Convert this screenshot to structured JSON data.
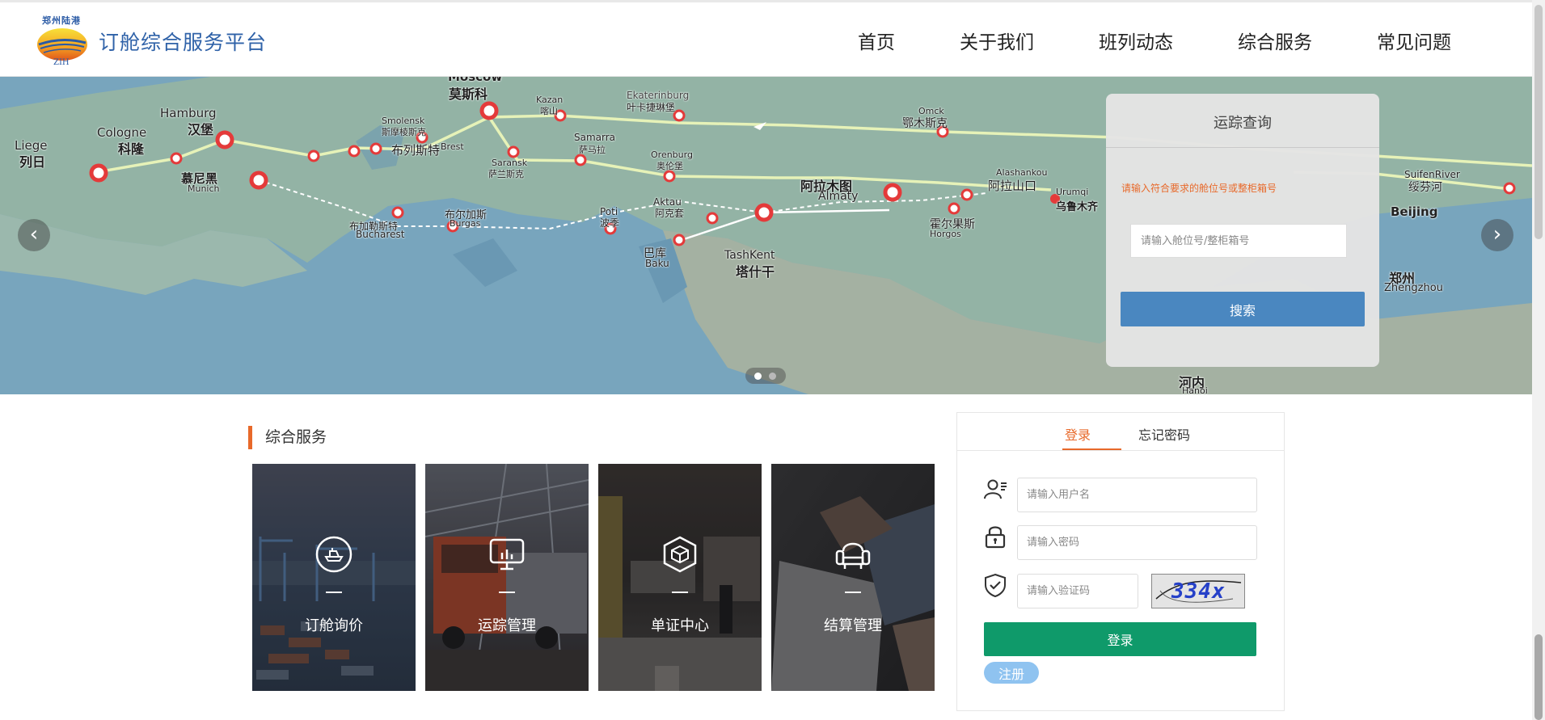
{
  "header": {
    "logo_top": "郑州陆港",
    "logo_sub": "ZIH",
    "brand": "订舱综合服务平台",
    "nav": [
      "首页",
      "关于我们",
      "班列动态",
      "综合服务",
      "常见问题"
    ]
  },
  "banner": {
    "cities": [
      {
        "cn": "莫斯科",
        "en": "Moscow"
      },
      {
        "cn": "汉堡",
        "en": "Hamburg"
      },
      {
        "cn": "科隆",
        "en": "Cologne"
      },
      {
        "cn": "列日",
        "en": "Liege"
      },
      {
        "cn": "慕尼黑",
        "en": "Munich"
      },
      {
        "cn": "斯摩棱斯克",
        "en": "Smolensk"
      },
      {
        "cn": "布列斯特",
        "en": "Brest"
      },
      {
        "cn": "喀山",
        "en": "Kazan"
      },
      {
        "cn": "萨马拉",
        "en": "Samarra"
      },
      {
        "cn": "萨兰斯克",
        "en": "Saransk"
      },
      {
        "cn": "叶卡捷琳堡",
        "en": "Ekaterinburg"
      },
      {
        "cn": "奥伦堡",
        "en": "Orenburg"
      },
      {
        "cn": "鄂木斯克",
        "en": "Omck"
      },
      {
        "cn": "阿拉木图",
        "en": "Almaty"
      },
      {
        "cn": "阿拉山口",
        "en": "Alashankou"
      },
      {
        "cn": "霍尔果斯",
        "en": "Horgos"
      },
      {
        "cn": "塔什干",
        "en": "TashKent"
      },
      {
        "cn": "巴库",
        "en": "Baku"
      },
      {
        "cn": "阿克套",
        "en": "Aktau"
      },
      {
        "cn": "波季",
        "en": "Poti"
      },
      {
        "cn": "布加勒斯特",
        "en": "Bucharest"
      },
      {
        "cn": "布尔加斯",
        "en": "Burgas"
      },
      {
        "cn": "乌鲁木齐",
        "en": "Urumqi"
      },
      {
        "cn": "绥芬河",
        "en": "SuifenRiver"
      },
      {
        "cn": "河内",
        "en": "Hanoi"
      },
      {
        "cn": "郑州",
        "en": "Zhengzhou"
      },
      {
        "cn": "",
        "en": "Beijing"
      }
    ],
    "prev_arrow": "‹",
    "next_arrow": "›"
  },
  "tracking": {
    "title": "运踪查询",
    "hint": "请输入符合要求的舱位号或整柜箱号",
    "placeholder": "请输入舱位号/整柜箱号",
    "search_label": "搜索"
  },
  "services": {
    "title": "综合服务",
    "cards": [
      {
        "label": "订舱询价",
        "icon": "ship-icon"
      },
      {
        "label": "运踪管理",
        "icon": "monitor-icon"
      },
      {
        "label": "单证中心",
        "icon": "cube-icon"
      },
      {
        "label": "结算管理",
        "icon": "armchair-icon"
      }
    ]
  },
  "login": {
    "tab_login": "登录",
    "tab_forgot": "忘记密码",
    "username_placeholder": "请输入用户名",
    "password_placeholder": "请输入密码",
    "captcha_placeholder": "请输入验证码",
    "captcha_text": "334x",
    "login_label": "登录",
    "register_label": "注册"
  },
  "colors": {
    "accent_orange": "#e8692a",
    "brand_blue": "#2f62a8",
    "search_blue": "#4a87c0",
    "login_green": "#0f9a6a",
    "register_blue": "#8fc3f0"
  }
}
